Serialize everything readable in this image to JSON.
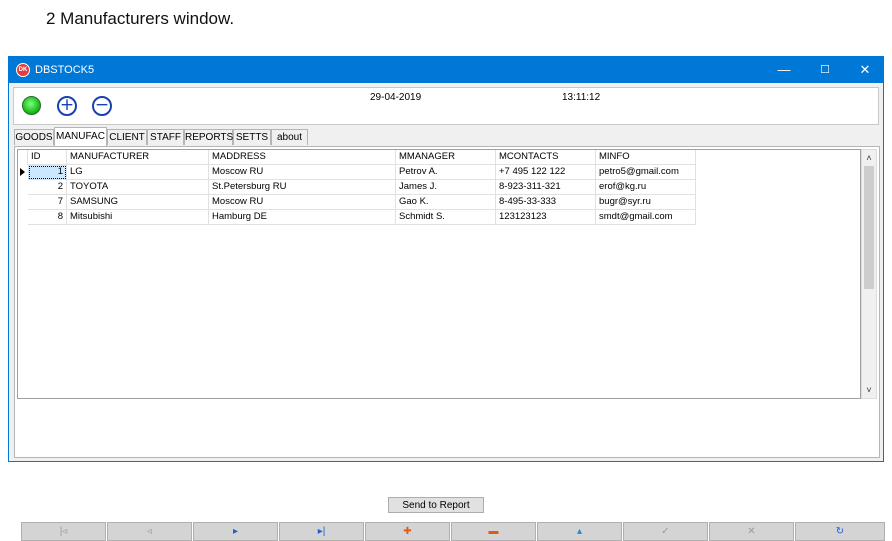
{
  "caption": "2 Manufacturers window.",
  "window": {
    "title": "DBSTOCK5",
    "icon_text": "DK",
    "minimize": "—",
    "maximize": "☐",
    "close": "✕"
  },
  "toolbar": {
    "status_led": "green-led",
    "add_symbol": "+",
    "remove_symbol": "−",
    "date": "29-04-2019",
    "time": "13:11:12"
  },
  "tabs": [
    "GOODS",
    "MANUFAC",
    "CLIENT",
    "STAFF",
    "REPORTS",
    "SETTS",
    "about"
  ],
  "active_tab": "MANUFAC",
  "grid": {
    "columns": [
      "ID",
      "MANUFACTURER",
      "MADDRESS",
      "MMANAGER",
      "MCONTACTS",
      "MINFO"
    ],
    "rows": [
      [
        "1",
        "LG",
        "Moscow RU",
        "Petrov A.",
        "+7 495 122 122",
        "petro5@gmail.com"
      ],
      [
        "2",
        "TOYOTA",
        "St.Petersburg RU",
        "James J.",
        "8-923-311-321",
        "erof@kg.ru"
      ],
      [
        "7",
        "SAMSUNG",
        "Moscow RU",
        "Gao K.",
        "8-495-33-333",
        "bugr@syr.ru"
      ],
      [
        "8",
        "Mitsubishi",
        "Hamburg DE",
        "Schmidt S.",
        "123123123",
        "smdt@gmail.com"
      ]
    ],
    "selected_row": 0
  },
  "scroll": {
    "up": "˄",
    "down": "˅"
  },
  "send_button": "Send to Report",
  "navigator": {
    "buttons": [
      {
        "name": "first-record",
        "glyph": "|◃",
        "color": "#9a9a9a"
      },
      {
        "name": "prior-record",
        "glyph": "◃",
        "color": "#9a9a9a"
      },
      {
        "name": "next-record",
        "glyph": "▸",
        "color": "#1a5fd0"
      },
      {
        "name": "last-record",
        "glyph": "▸|",
        "color": "#1a5fd0"
      },
      {
        "name": "insert-record",
        "glyph": "✚",
        "color": "#e05a1a"
      },
      {
        "name": "delete-record",
        "glyph": "▬",
        "color": "#e05a1a"
      },
      {
        "name": "edit-record",
        "glyph": "▴",
        "color": "#1a8fd0"
      },
      {
        "name": "post-edit",
        "glyph": "✓",
        "color": "#9a9a9a"
      },
      {
        "name": "cancel-edit",
        "glyph": "✕",
        "color": "#9a9a9a"
      },
      {
        "name": "refresh-data",
        "glyph": "↻",
        "color": "#1a5fd0"
      }
    ]
  }
}
